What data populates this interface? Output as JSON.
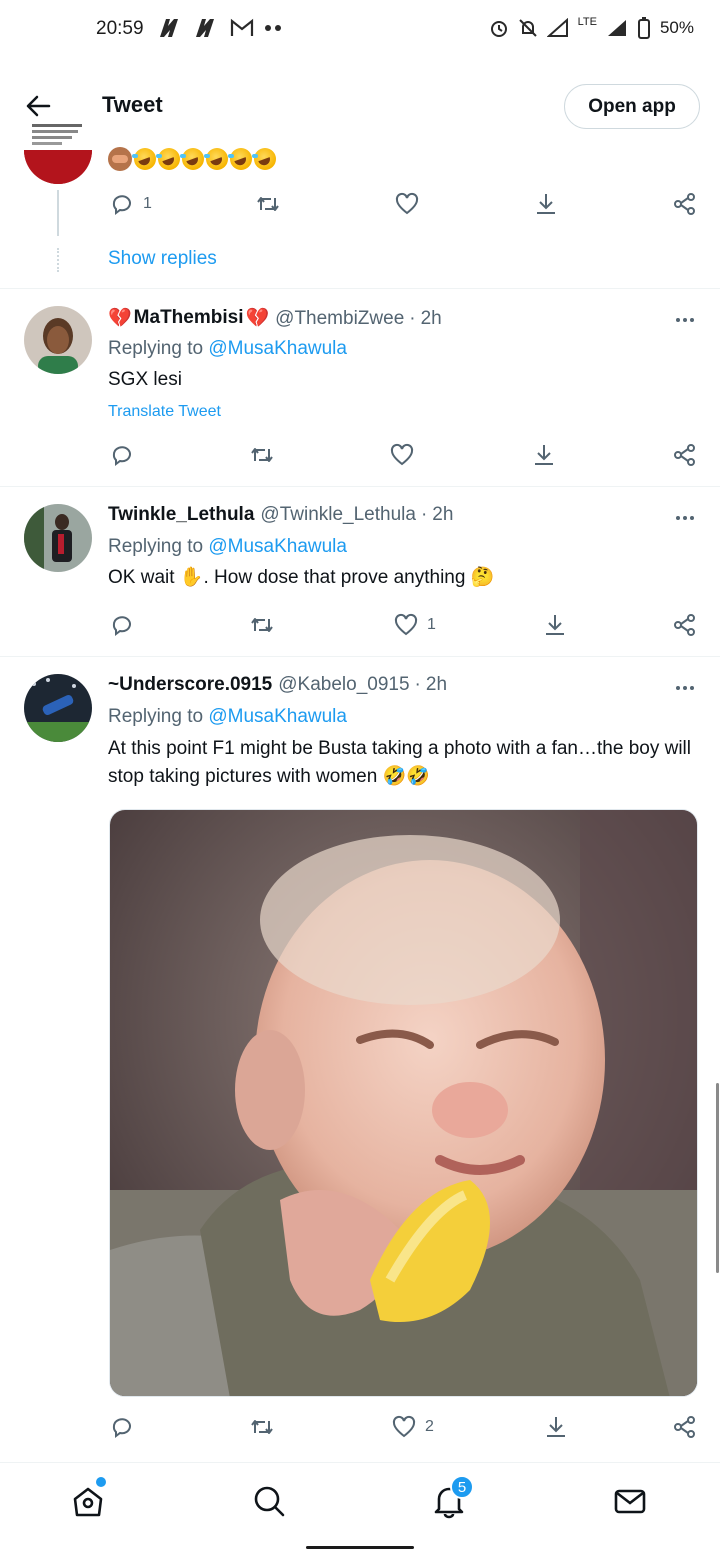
{
  "status_bar": {
    "time": "20:59",
    "battery": "50%",
    "network": "LTE"
  },
  "header": {
    "title": "Tweet",
    "open_app_label": "Open app"
  },
  "partial_tweet": {
    "emoji_text": "🙈🤣🤣🤣🤣🤣🤣",
    "reply_count": "1",
    "show_replies_label": "Show replies"
  },
  "tweets": [
    {
      "name": "MaThembisi",
      "name_emoji": "💔",
      "handle": "@ThembiZwee",
      "separator": "·",
      "time": "2h",
      "replying_prefix": "Replying to",
      "replying_to": "@MusaKhawula",
      "text": "SGX lesi",
      "translate_label": "Translate Tweet",
      "likes": ""
    },
    {
      "name": "Twinkle_Lethula",
      "handle": "@Twinkle_Lethula",
      "separator": "·",
      "time": "2h",
      "replying_prefix": "Replying to",
      "replying_to": "@MusaKhawula",
      "text_before": "OK wait ",
      "text_emoji1": "✋",
      "text_middle": ". How dose that prove anything ",
      "text_emoji2": "🤔",
      "likes": "1"
    },
    {
      "name": "~Underscore.0915",
      "handle": "@Kabelo_0915",
      "separator": "·",
      "time": "2h",
      "replying_prefix": "Replying to",
      "replying_to": "@MusaKhawula",
      "text": "At this point F1 might be Busta taking a photo with a fan…the boy will stop taking pictures with women",
      "text_emoji": "🤣🤣",
      "likes": "2"
    }
  ],
  "bottom_nav": {
    "items": [
      "home-icon",
      "search-icon",
      "notifications-icon",
      "messages-icon"
    ],
    "notification_count": "5"
  },
  "colors": {
    "accent": "#1d9bf0",
    "text_primary": "#0f1419",
    "text_secondary": "#536471",
    "heart_red": "#e0245e"
  }
}
